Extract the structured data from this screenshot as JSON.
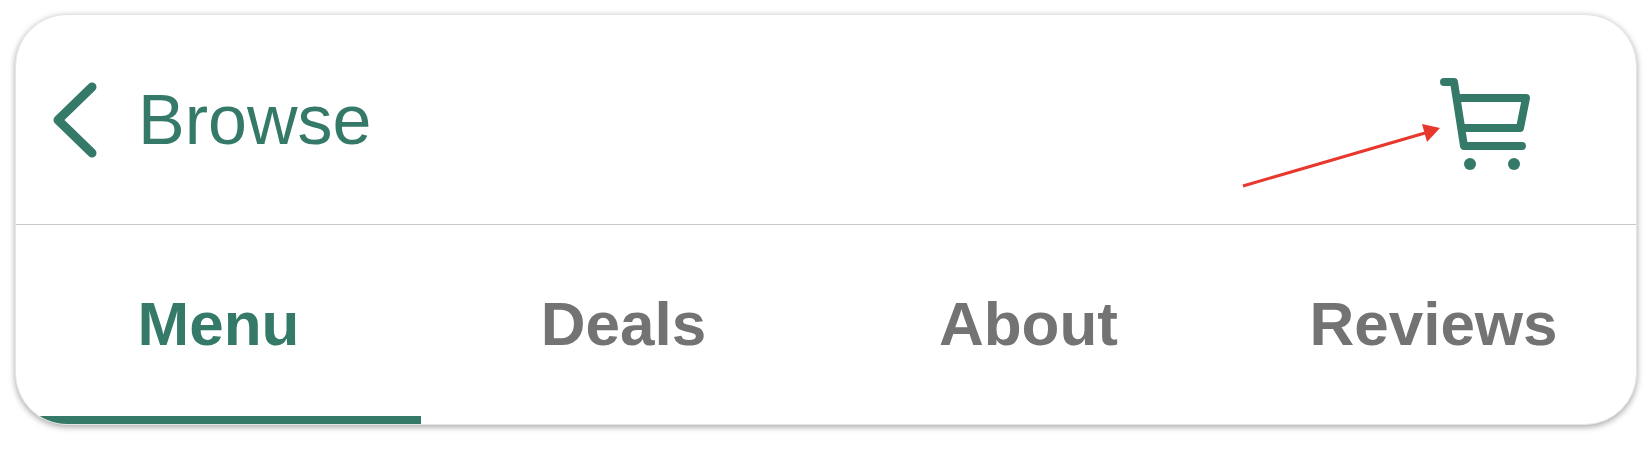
{
  "header": {
    "back_label": "Browse"
  },
  "tabs": [
    {
      "label": "Menu",
      "selected": true
    },
    {
      "label": "Deals",
      "selected": false
    },
    {
      "label": "About",
      "selected": false
    },
    {
      "label": "Reviews",
      "selected": false
    }
  ]
}
